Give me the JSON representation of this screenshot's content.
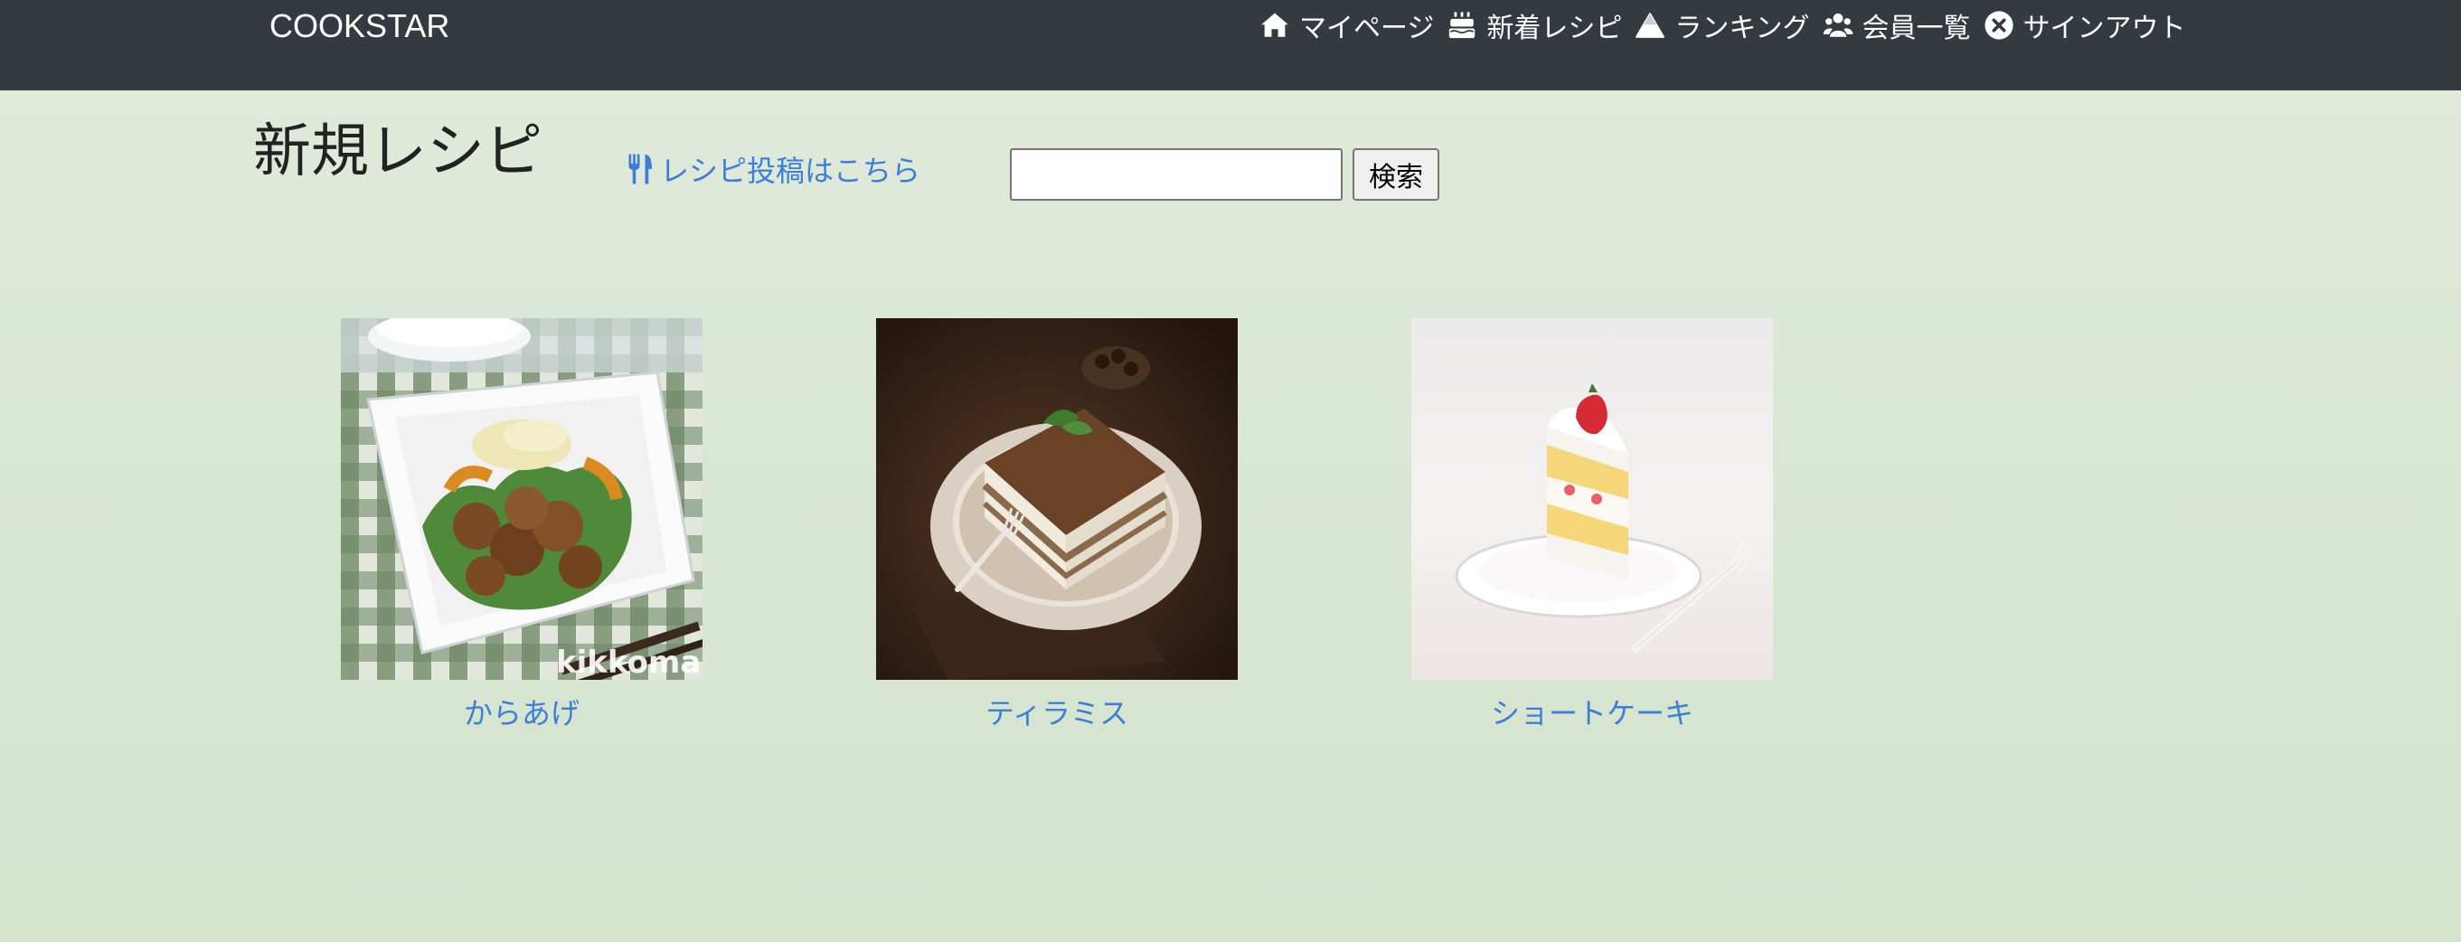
{
  "app": {
    "brand": "COOKSTAR"
  },
  "nav": {
    "items": [
      {
        "label": "マイページ",
        "icon": "home-icon"
      },
      {
        "label": "新着レシピ",
        "icon": "cake-icon"
      },
      {
        "label": "ランキング",
        "icon": "triangle-icon"
      },
      {
        "label": "会員一覧",
        "icon": "users-icon"
      },
      {
        "label": "サインアウト",
        "icon": "close-circle-icon"
      }
    ]
  },
  "main": {
    "title": "新規レシピ",
    "post_link": {
      "label": "レシピ投稿はこちら",
      "icon": "utensils-icon"
    },
    "search": {
      "value": "",
      "placeholder": "",
      "button_label": "検索"
    },
    "recipes": [
      {
        "title": "からあげ",
        "watermark": "kikkoman"
      },
      {
        "title": "ティラミス"
      },
      {
        "title": "ショートケーキ"
      }
    ]
  },
  "colors": {
    "navbar": "#343a40",
    "link": "#3d7fd6",
    "background_top": "#e1eadc",
    "background_bottom": "#d3e3cc"
  }
}
